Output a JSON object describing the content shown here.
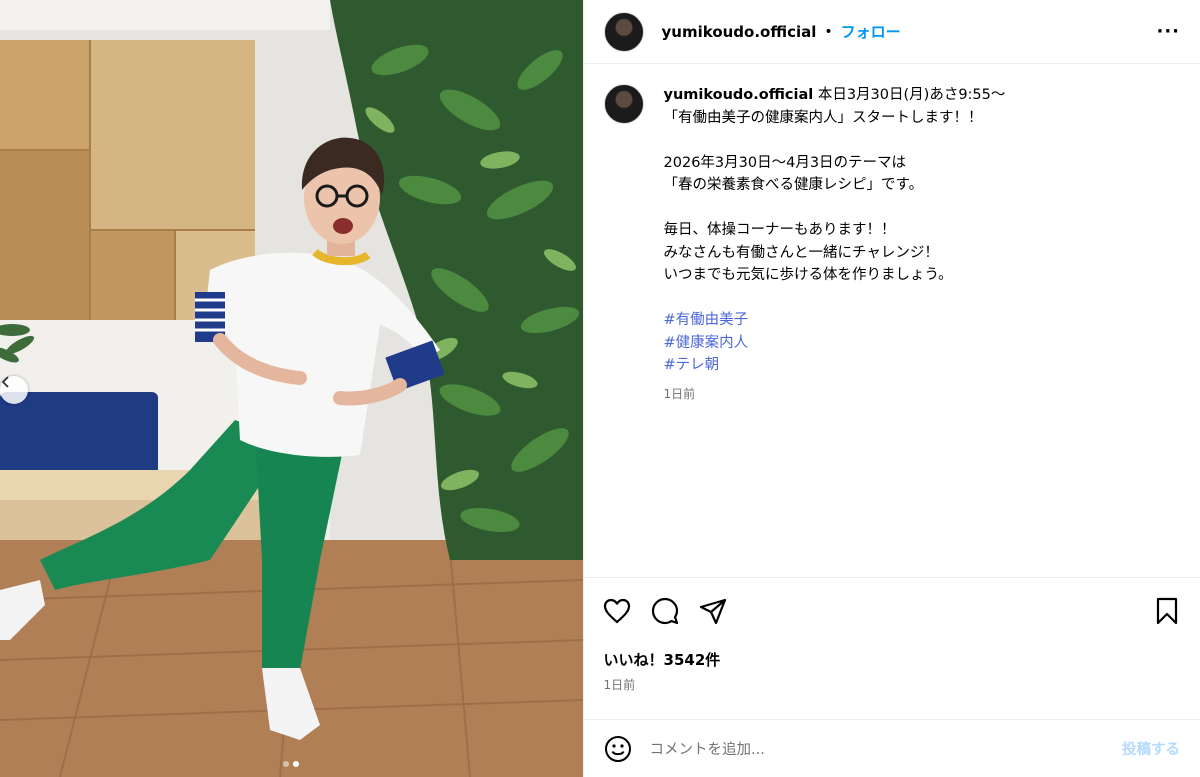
{
  "header": {
    "username": "yumikoudo.official",
    "separator": "•",
    "follow_label": "フォロー",
    "more_label": "···"
  },
  "caption": {
    "username": "yumikoudo.official",
    "lines": [
      "本日3月30日(月)あさ9:55〜",
      "「有働由美子の健康案内人」スタートします！！",
      "",
      "2026年3月30日〜4月3日のテーマは",
      "「春の栄養素食べる健康レシピ」です。",
      "",
      "毎日、体操コーナーもあります！！",
      "みなさんも有働さんと一緒にチャレンジ！",
      "いつまでも元気に歩ける体を作りましょう。"
    ],
    "hashtags": [
      "#有働由美子",
      "#健康案内人",
      "#テレ朝"
    ],
    "time": "1日前"
  },
  "engagement": {
    "likes": "いいね！3542件",
    "time": "1日前"
  },
  "comment": {
    "placeholder": "コメントを追加...",
    "post_label": "投稿する"
  },
  "media": {
    "carousel_count": 2,
    "active_index": 1
  },
  "colors": {
    "accent": "#0095f6",
    "hashtag": "#4c68d7",
    "post_disabled": "#b3dbff",
    "muted": "#737373"
  }
}
